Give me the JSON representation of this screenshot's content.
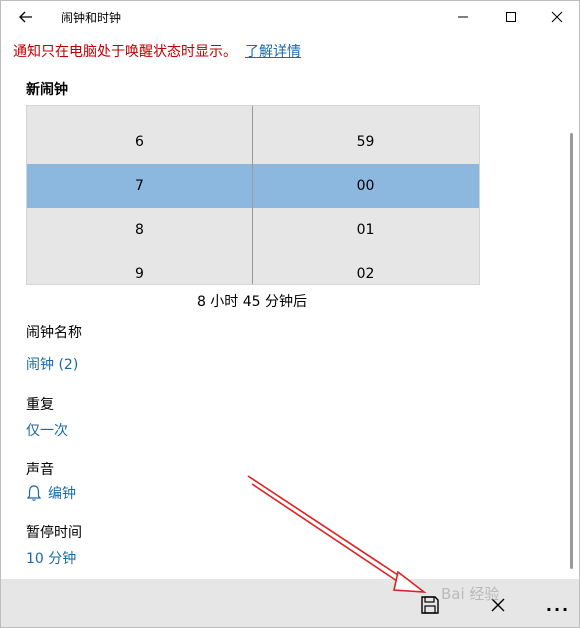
{
  "window": {
    "title": "闹钟和时钟"
  },
  "notice": {
    "text": "通知只在电脑处于唤醒状态时显示。",
    "link": "了解详情"
  },
  "section_title": "新闹钟",
  "picker": {
    "hours": [
      "6",
      "7",
      "8",
      "9"
    ],
    "minutes": [
      "59",
      "00",
      "01",
      "02"
    ],
    "selected_hour": "7",
    "selected_minute": "00"
  },
  "countdown": "8 小时 45 分钟后",
  "fields": {
    "name": {
      "label": "闹钟名称",
      "value": "闹钟 (2)"
    },
    "repeat": {
      "label": "重复",
      "value": "仅一次"
    },
    "sound": {
      "label": "声音",
      "value": "编钟"
    },
    "snooze": {
      "label": "暂停时间",
      "value": "10 分钟"
    }
  },
  "commandbar": {
    "more": "..."
  },
  "watermark": "Bai 经验",
  "colors": {
    "accent": "#1a6aa6",
    "warning": "#c00000",
    "selection": "#8cb8e0",
    "picker_bg": "#e6e6e6",
    "annotation_arrow": "#e02020"
  }
}
